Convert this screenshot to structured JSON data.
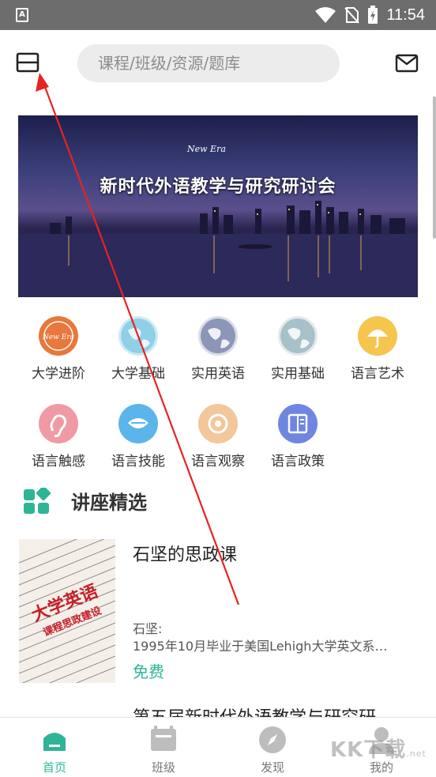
{
  "status_bar": {
    "time": "11:54"
  },
  "header": {
    "search_placeholder": "课程/班级/资源/题库"
  },
  "banner": {
    "title": "新时代外语教学与研究研讨会",
    "logo_text": "New Era"
  },
  "categories": [
    {
      "label": "大学进阶",
      "icon": "new-era-badge-icon",
      "color": "#e8783c"
    },
    {
      "label": "大学基础",
      "icon": "globe-icon",
      "color": "#8fd0e6"
    },
    {
      "label": "实用英语",
      "icon": "globe-icon",
      "color": "#8b96b8"
    },
    {
      "label": "实用基础",
      "icon": "globe-icon",
      "color": "#a7c1c8"
    },
    {
      "label": "语言艺术",
      "icon": "umbrella-icon",
      "color": "#f5c54e"
    },
    {
      "label": "语言触感",
      "icon": "ear-icon",
      "color": "#f09aa4"
    },
    {
      "label": "语言技能",
      "icon": "mouth-icon",
      "color": "#5cb5ea"
    },
    {
      "label": "语言观察",
      "icon": "eye-icon",
      "color": "#f2c79a"
    },
    {
      "label": "语言政策",
      "icon": "book-icon",
      "color": "#6f86e0"
    }
  ],
  "section": {
    "title": "讲座精选"
  },
  "lectures": [
    {
      "title": "石坚的思政课",
      "author": "石坚:",
      "description": "1995年10月毕业于美国Lehigh大学英文系…",
      "price": "免费",
      "cover_big": "大学英语",
      "cover_sub": "课程思政建设"
    },
    {
      "title": "第五届新时代外语教学与研究研"
    }
  ],
  "bottom_nav": [
    {
      "label": "首页",
      "icon": "home-icon",
      "active": true
    },
    {
      "label": "班级",
      "icon": "class-icon",
      "active": false
    },
    {
      "label": "发现",
      "icon": "compass-icon",
      "active": false
    },
    {
      "label": "我的",
      "icon": "user-icon",
      "active": false
    }
  ],
  "watermark": {
    "text": "KK下载",
    "sub": ".net"
  },
  "colors": {
    "accent": "#2eb597",
    "status_bar": "#6d6d6d",
    "search_bg": "#ececec"
  }
}
